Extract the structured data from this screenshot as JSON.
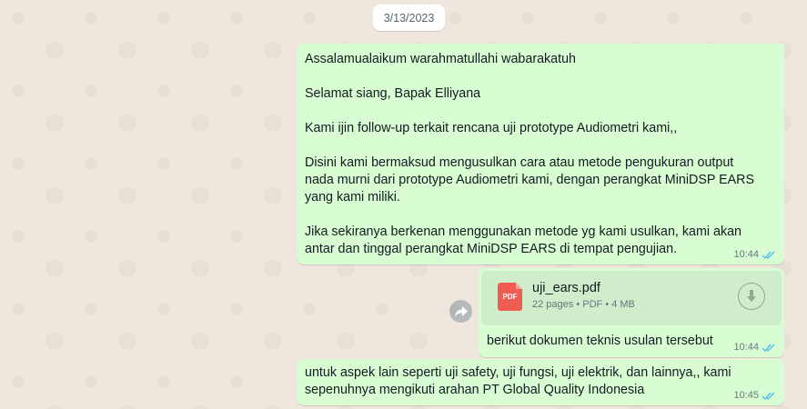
{
  "chat": {
    "date_separator": "3/13/2023",
    "messages": [
      {
        "type": "text",
        "paragraphs": [
          "Assalamualaikum warahmatullahi wabarakatuh",
          "Selamat siang, Bapak Elliyana",
          "Kami ijin follow-up terkait rencana uji prototype Audiometri kami,,",
          "Disini kami bermaksud mengusulkan cara atau metode pengukuran output nada murni dari prototype Audiometri kami, dengan perangkat MiniDSP EARS yang kami miliki.",
          "Jika sekiranya berkenan menggunakan metode yg kami usulkan, kami akan antar dan tinggal perangkat MiniDSP EARS di tempat pengujian."
        ],
        "time": "10:44",
        "status": "read"
      },
      {
        "type": "document",
        "file_name": "uji_ears.pdf",
        "file_info": "22 pages • PDF • 4 MB",
        "file_badge": "PDF",
        "caption": "berikut dokumen teknis usulan tersebut",
        "time": "10:44",
        "status": "read"
      },
      {
        "type": "text",
        "paragraphs": [
          "untuk aspek lain seperti uji safety, uji fungsi, uji elektrik, dan lainnya,, kami sepenuhnya mengikuti arahan PT Global Quality Indonesia"
        ],
        "time": "10:45",
        "status": "read"
      }
    ]
  },
  "icons": {
    "read_ticks": "double-check-icon",
    "download": "download-icon",
    "forward": "forward-icon",
    "pdf": "pdf-file-icon"
  },
  "colors": {
    "outgoing_bubble": "#d9fdd3",
    "read_tick": "#53bdeb",
    "pdf_red": "#f15c52"
  }
}
